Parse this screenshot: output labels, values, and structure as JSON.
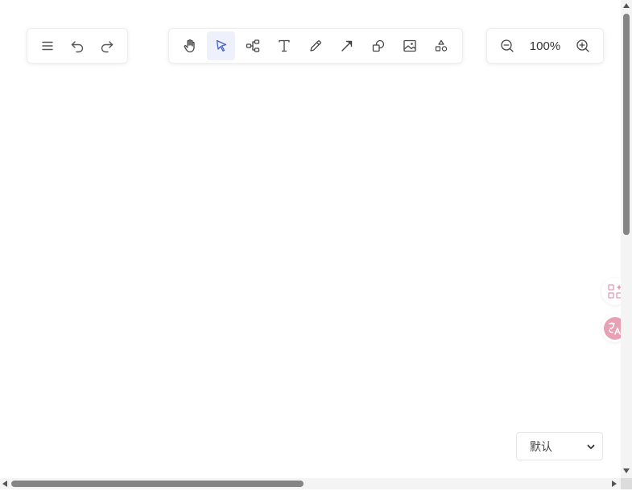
{
  "toolbar_left": {
    "items": [
      {
        "icon": "menu-icon"
      },
      {
        "icon": "undo-icon"
      },
      {
        "icon": "redo-icon"
      }
    ]
  },
  "toolbar_center": {
    "active_tool": "select",
    "items": [
      {
        "icon": "hand-icon"
      },
      {
        "icon": "cursor-icon"
      },
      {
        "icon": "mindmap-icon"
      },
      {
        "icon": "text-icon"
      },
      {
        "icon": "pencil-icon"
      },
      {
        "icon": "arrow-icon"
      },
      {
        "icon": "shape-icon"
      },
      {
        "icon": "image-icon"
      },
      {
        "icon": "more-shapes-icon"
      }
    ]
  },
  "zoom": {
    "value": "100%"
  },
  "side": {
    "apps_icon": "apps-sparkle-icon",
    "translate_icon": "translate-icon",
    "accent_color": "#e8a0b4"
  },
  "theme_select": {
    "selected": "默认"
  }
}
